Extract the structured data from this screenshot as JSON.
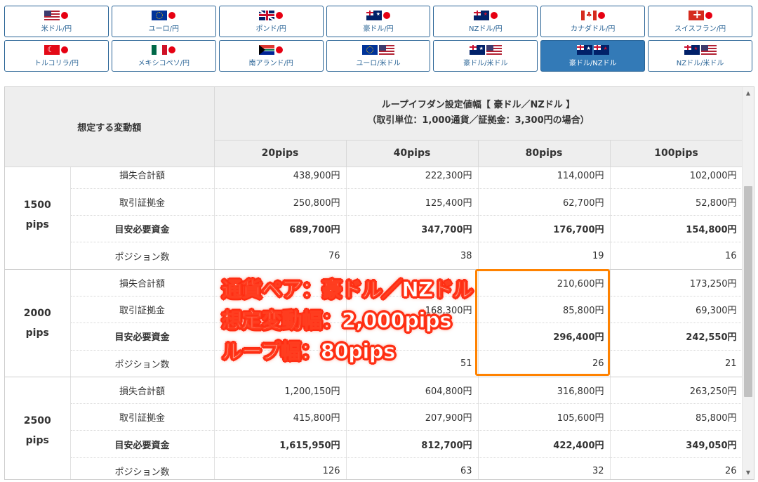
{
  "tabs": {
    "row1": [
      {
        "label": "米ドル/円",
        "flags": [
          "us",
          "jp-dot"
        ]
      },
      {
        "label": "ユーロ/円",
        "flags": [
          "eu",
          "jp-dot"
        ]
      },
      {
        "label": "ポンド/円",
        "flags": [
          "uk",
          "jp-dot"
        ]
      },
      {
        "label": "豪ドル/円",
        "flags": [
          "au",
          "jp-dot"
        ]
      },
      {
        "label": "NZドル/円",
        "flags": [
          "nz",
          "jp-dot"
        ]
      },
      {
        "label": "カナダドル/円",
        "flags": [
          "ca",
          "jp-dot"
        ]
      },
      {
        "label": "スイスフラン/円",
        "flags": [
          "ch",
          "jp-dot"
        ]
      }
    ],
    "row2": [
      {
        "label": "トルコリラ/円",
        "flags": [
          "tr",
          "jp-dot"
        ]
      },
      {
        "label": "メキシコペソ/円",
        "flags": [
          "mx",
          "jp-dot"
        ]
      },
      {
        "label": "南アランド/円",
        "flags": [
          "za",
          "jp-dot"
        ]
      },
      {
        "label": "ユーロ/米ドル",
        "flags": [
          "eu",
          "us"
        ]
      },
      {
        "label": "豪ドル/米ドル",
        "flags": [
          "au",
          "us"
        ]
      },
      {
        "label": "豪ドル/NZドル",
        "flags": [
          "au",
          "nz"
        ],
        "active": true
      },
      {
        "label": "NZドル/米ドル",
        "flags": [
          "nz",
          "us"
        ]
      }
    ]
  },
  "table": {
    "corner_label": "想定する変動額",
    "title_line1": "ループイフダン設定値幅【 豪ドル／NZドル 】",
    "title_line2": "（取引単位：1,000通貨／証拠金：3,300円の場合）",
    "columns": [
      "20pips",
      "40pips",
      "80pips",
      "100pips"
    ],
    "groups": [
      {
        "range_top": "1500",
        "range_bottom": "pips",
        "rows": [
          {
            "label": "損失合計額",
            "bold": false,
            "values": [
              "438,900円",
              "222,300円",
              "114,000円",
              "102,000円"
            ]
          },
          {
            "label": "取引証拠金",
            "bold": false,
            "values": [
              "250,800円",
              "125,400円",
              "62,700円",
              "52,800円"
            ]
          },
          {
            "label": "目安必要資金",
            "bold": true,
            "values": [
              "689,700円",
              "347,700円",
              "176,700円",
              "154,800円"
            ]
          },
          {
            "label": "ポジション数",
            "bold": false,
            "values": [
              "76",
              "38",
              "19",
              "16"
            ]
          }
        ]
      },
      {
        "range_top": "2000",
        "range_bottom": "pips",
        "rows": [
          {
            "label": "損失合計額",
            "bold": false,
            "values": [
              "",
              "",
              "210,600円",
              "173,250円"
            ]
          },
          {
            "label": "取引証拠金",
            "bold": false,
            "values": [
              "",
              "168,300円",
              "85,800円",
              "69,300円"
            ]
          },
          {
            "label": "目安必要資金",
            "bold": true,
            "values": [
              "",
              "",
              "296,400円",
              "242,550円"
            ]
          },
          {
            "label": "ポジション数",
            "bold": false,
            "values": [
              "",
              "51",
              "26",
              "21"
            ]
          }
        ]
      },
      {
        "range_top": "2500",
        "range_bottom": "pips",
        "rows": [
          {
            "label": "損失合計額",
            "bold": false,
            "values": [
              "1,200,150円",
              "604,800円",
              "316,800円",
              "263,250円"
            ]
          },
          {
            "label": "取引証拠金",
            "bold": false,
            "values": [
              "415,800円",
              "207,900円",
              "105,600円",
              "85,800円"
            ]
          },
          {
            "label": "目安必要資金",
            "bold": true,
            "values": [
              "1,615,950円",
              "812,700円",
              "422,400円",
              "349,050円"
            ]
          },
          {
            "label": "ポジション数",
            "bold": false,
            "values": [
              "126",
              "63",
              "32",
              "26"
            ]
          }
        ]
      }
    ]
  },
  "overlay": {
    "line1": "通貨ペア：豪ドル／NZドル",
    "line2": "想定変動幅：2,000pips",
    "line3": "ループ幅：80pips"
  },
  "colors": {
    "active_tab": "#337ab7",
    "highlight_border": "#ff8200",
    "overlay_stroke": "#ff2a14"
  },
  "scroll": {
    "position_fraction": 0.46
  }
}
